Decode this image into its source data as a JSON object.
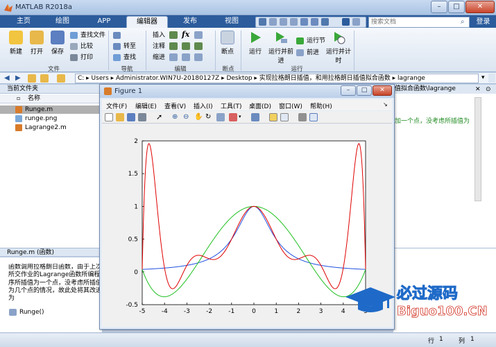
{
  "app": {
    "title": "MATLAB R2018a",
    "window_controls": [
      "–",
      "□",
      "✕"
    ]
  },
  "tabs": [
    {
      "label": "主页",
      "active": false
    },
    {
      "label": "绘图",
      "active": false
    },
    {
      "label": "APP",
      "active": false
    },
    {
      "label": "编辑器",
      "active": true
    },
    {
      "label": "发布",
      "active": false
    },
    {
      "label": "视图",
      "active": false
    }
  ],
  "search": {
    "placeholder": "搜索文档",
    "icon": "search-icon"
  },
  "login_label": "登录",
  "ribbon": {
    "file": {
      "new": "新建",
      "open": "打开",
      "save": "保存",
      "find_files": "查找文件",
      "compare": "比较",
      "print": "打印",
      "group": "文件"
    },
    "navigate": {
      "goto": "转至",
      "find": "查找",
      "group": "导航"
    },
    "edit": {
      "insert": "插入",
      "comment": "注释",
      "indent": "缩进",
      "fx": "fx",
      "group": "编辑"
    },
    "breakpoints": {
      "label": "断点",
      "group": "断点"
    },
    "run": {
      "run": "运行",
      "run_advance": "运行并前进",
      "run_section": "运行节",
      "advance": "前进",
      "run_time": "运行并计时",
      "group": "运行"
    }
  },
  "address": {
    "path": "C: ▸ Users ▸ Administrator.WIN7U-20180127Z ▸ Desktop ▸ 实现拉格朗日插值，和用拉格朗日插值拟合函数 ▸ lagrange"
  },
  "current_folder": {
    "header": "当前文件夹",
    "column": "名称",
    "files": [
      {
        "name": "Runge.m",
        "selected": true
      },
      {
        "name": "runge.png",
        "selected": false
      },
      {
        "name": "Lagrange2.m",
        "selected": false
      }
    ]
  },
  "detail": {
    "header": "Runge.m  (函数)",
    "text": "函数调用拉格朗日函数，由于上次\n所交作业的Lagrange函数所编程\n序所插值为一个点，没考虑所插值\n为几个点的情况，故此处将其改进\n为",
    "function": "Runge()"
  },
  "editor": {
    "tab": "值拟合函数\\lagrange",
    "line": "加一个点，没考虑所插值为"
  },
  "status": {
    "row_label": "行",
    "row": "1",
    "col_label": "列",
    "col": "1"
  },
  "figure": {
    "title": "Figure 1",
    "controls": [
      "–",
      "□",
      "✕"
    ],
    "menus": [
      "文件(F)",
      "编辑(E)",
      "查看(V)",
      "插入(I)",
      "工具(T)",
      "桌面(D)",
      "窗口(W)",
      "帮助(H)"
    ]
  },
  "chart_data": {
    "type": "line",
    "title": "",
    "xlabel": "",
    "ylabel": "",
    "xlim": [
      -5,
      5
    ],
    "ylim": [
      -0.5,
      2
    ],
    "xticks": [
      -5,
      -4,
      -3,
      -2,
      -1,
      0,
      1,
      2,
      3,
      4,
      5
    ],
    "yticks": [
      -0.5,
      0,
      0.5,
      1,
      1.5,
      2
    ],
    "grid": false,
    "series": [
      {
        "color": "#2050e0",
        "function": "1/(1+x^2)"
      },
      {
        "color": "#20c020",
        "function": "lagrange interpolant, 5 nodes on [-5,5]",
        "nodes": 5
      },
      {
        "color": "#e00000",
        "function": "lagrange interpolant, 11 nodes on [-5,5]",
        "nodes": 11
      }
    ]
  },
  "watermark": {
    "line1": "必过源码",
    "line2": "Biguo100.CN"
  },
  "colors": {
    "accent": "#2c5c9c",
    "ribbon": "#dbe5f1"
  }
}
